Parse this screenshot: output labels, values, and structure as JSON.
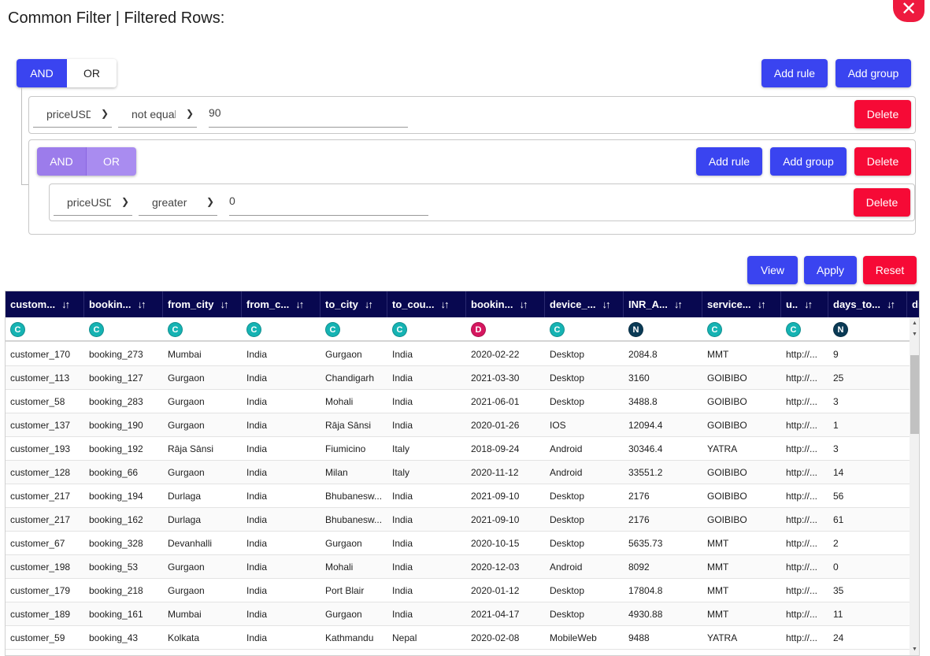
{
  "title": "Common Filter | Filtered Rows:",
  "close_icon": "close-icon",
  "colors": {
    "primary": "#3a44f0",
    "danger": "#f60a36",
    "header_bg": "#080850",
    "nested_toggle": "#9f80ee"
  },
  "query": {
    "combinator_and": "AND",
    "combinator_or": "OR",
    "add_rule": "Add rule",
    "add_group": "Add group",
    "delete": "Delete",
    "rule1": {
      "field": "priceUSD",
      "operator": "not equal",
      "value": "90"
    },
    "group": {
      "combinator_and": "AND",
      "combinator_or": "OR",
      "rule1": {
        "field": "priceUSD",
        "operator": "greater",
        "value": "0"
      }
    }
  },
  "actions": {
    "view": "View",
    "apply": "Apply",
    "reset": "Reset"
  },
  "grid": {
    "columns": [
      {
        "label": "custom...",
        "type": "C",
        "sort": "↓↑"
      },
      {
        "label": "bookin...",
        "type": "C",
        "sort": "↓↑"
      },
      {
        "label": "from_city",
        "type": "C",
        "sort": "↓↑"
      },
      {
        "label": "from_c...",
        "type": "C",
        "sort": "↓↑"
      },
      {
        "label": "to_city",
        "type": "C",
        "sort": "↓↑"
      },
      {
        "label": "to_cou...",
        "type": "C",
        "sort": "↓↑"
      },
      {
        "label": "bookin...",
        "type": "D",
        "sort": "↓↑"
      },
      {
        "label": "device_...",
        "type": "C",
        "sort": "↓↑"
      },
      {
        "label": "INR_A...",
        "type": "N",
        "sort": "↓↑"
      },
      {
        "label": "service...",
        "type": "C",
        "sort": "↓↑"
      },
      {
        "label": "u..",
        "type": "C",
        "sort": "↓↑"
      },
      {
        "label": "days_to...",
        "type": "N",
        "sort": "↓↑"
      },
      {
        "label": "di",
        "type": "",
        "sort": ""
      }
    ],
    "rows": [
      [
        "customer_170",
        "booking_273",
        "Mumbai",
        "India",
        "Gurgaon",
        "India",
        "2020-02-22",
        "Desktop",
        "2084.8",
        "MMT",
        "http://...",
        "9"
      ],
      [
        "customer_113",
        "booking_127",
        "Gurgaon",
        "India",
        "Chandigarh",
        "India",
        "2021-03-30",
        "Desktop",
        "3160",
        "GOIBIBO",
        "http://...",
        "25"
      ],
      [
        "customer_58",
        "booking_283",
        "Gurgaon",
        "India",
        "Mohali",
        "India",
        "2021-06-01",
        "Desktop",
        "3488.8",
        "GOIBIBO",
        "http://...",
        "3"
      ],
      [
        "customer_137",
        "booking_190",
        "Gurgaon",
        "India",
        "Rāja Sānsi",
        "India",
        "2020-01-26",
        "IOS",
        "12094.4",
        "GOIBIBO",
        "http://...",
        "1"
      ],
      [
        "customer_193",
        "booking_192",
        "Rāja Sānsi",
        "India",
        "Fiumicino",
        "Italy",
        "2018-09-24",
        "Android",
        "30346.4",
        "YATRA",
        "http://...",
        "3"
      ],
      [
        "customer_128",
        "booking_66",
        "Gurgaon",
        "India",
        "Milan",
        "Italy",
        "2020-11-12",
        "Android",
        "33551.2",
        "GOIBIBO",
        "http://...",
        "14"
      ],
      [
        "customer_217",
        "booking_194",
        "Durlaga",
        "India",
        "Bhubanesw...",
        "India",
        "2021-09-10",
        "Desktop",
        "2176",
        "GOIBIBO",
        "http://...",
        "56"
      ],
      [
        "customer_217",
        "booking_162",
        "Durlaga",
        "India",
        "Bhubanesw...",
        "India",
        "2021-09-10",
        "Desktop",
        "2176",
        "GOIBIBO",
        "http://...",
        "61"
      ],
      [
        "customer_67",
        "booking_328",
        "Devanhalli",
        "India",
        "Gurgaon",
        "India",
        "2020-10-15",
        "Desktop",
        "5635.73",
        "MMT",
        "http://...",
        "2"
      ],
      [
        "customer_198",
        "booking_53",
        "Gurgaon",
        "India",
        "Mohali",
        "India",
        "2020-12-03",
        "Android",
        "8092",
        "MMT",
        "http://...",
        "0"
      ],
      [
        "customer_179",
        "booking_218",
        "Gurgaon",
        "India",
        "Port Blair",
        "India",
        "2020-01-12",
        "Desktop",
        "17804.8",
        "MMT",
        "http://...",
        "35"
      ],
      [
        "customer_189",
        "booking_161",
        "Mumbai",
        "India",
        "Gurgaon",
        "India",
        "2021-04-17",
        "Desktop",
        "4930.88",
        "MMT",
        "http://...",
        "11"
      ],
      [
        "customer_59",
        "booking_43",
        "Kolkata",
        "India",
        "Kathmandu",
        "Nepal",
        "2020-02-08",
        "MobileWeb",
        "9488",
        "YATRA",
        "http://...",
        "24"
      ]
    ]
  }
}
